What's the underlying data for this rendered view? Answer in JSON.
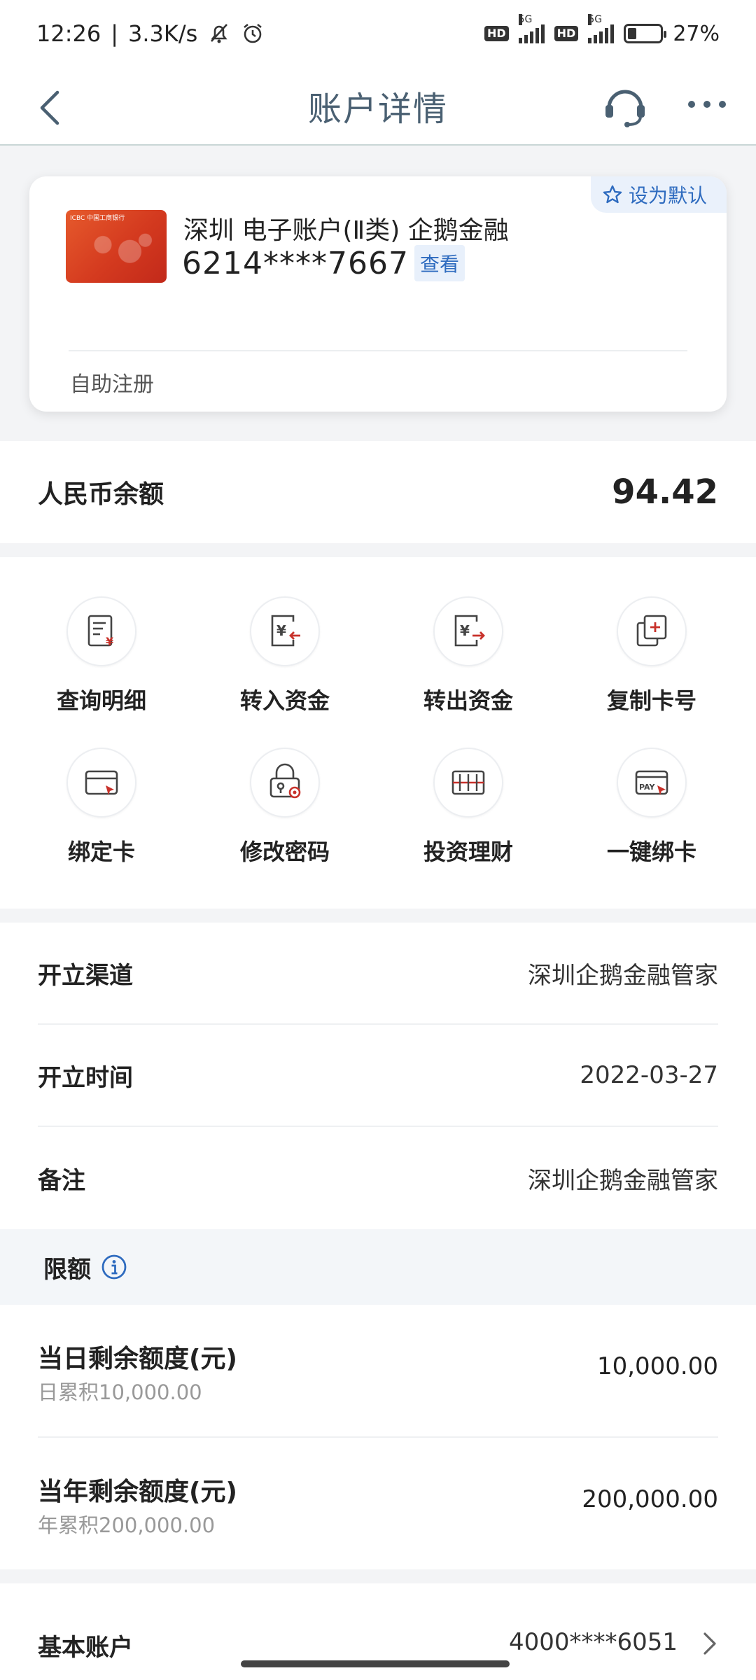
{
  "status_bar": {
    "time": "12:26",
    "net_speed": "3.3K/s",
    "network_1": "5G",
    "network_2": "5G",
    "hd": "HD",
    "battery_text": "27%",
    "battery_level": 0.27
  },
  "nav": {
    "title": "账户详情"
  },
  "card": {
    "default_label": "设为默认",
    "name": "深圳 电子账户(Ⅱ类) 企鹅金融",
    "number": "6214****7667",
    "view_label": "查看",
    "footer": "自助注册",
    "thumb_text": "ICBC 中国工商银行"
  },
  "balance": {
    "label": "人民币余额",
    "value": "94.42"
  },
  "actions": [
    {
      "label": "查询明细",
      "icon": "statement-icon"
    },
    {
      "label": "转入资金",
      "icon": "transfer-in-icon"
    },
    {
      "label": "转出资金",
      "icon": "transfer-out-icon"
    },
    {
      "label": "复制卡号",
      "icon": "copy-card-icon"
    },
    {
      "label": "绑定卡",
      "icon": "bind-card-icon"
    },
    {
      "label": "修改密码",
      "icon": "change-password-icon"
    },
    {
      "label": "投资理财",
      "icon": "investment-icon"
    },
    {
      "label": "一键绑卡",
      "icon": "quick-bind-icon"
    }
  ],
  "info": [
    {
      "label": "开立渠道",
      "value": "深圳企鹅金融管家"
    },
    {
      "label": "开立时间",
      "value": "2022-03-27"
    },
    {
      "label": "备注",
      "value": "深圳企鹅金融管家"
    }
  ],
  "limits": {
    "title": "限额",
    "rows": [
      {
        "title": "当日剩余额度(元)",
        "sub": "日累积10,000.00",
        "value": "10,000.00"
      },
      {
        "title": "当年剩余额度(元)",
        "sub": "年累积200,000.00",
        "value": "200,000.00"
      }
    ]
  },
  "basic_account": {
    "label": "基本账户",
    "value": "4000****6051"
  },
  "colors": {
    "accent": "#2e6bbf",
    "icon_red": "#c8312a",
    "title": "#4a6072"
  }
}
